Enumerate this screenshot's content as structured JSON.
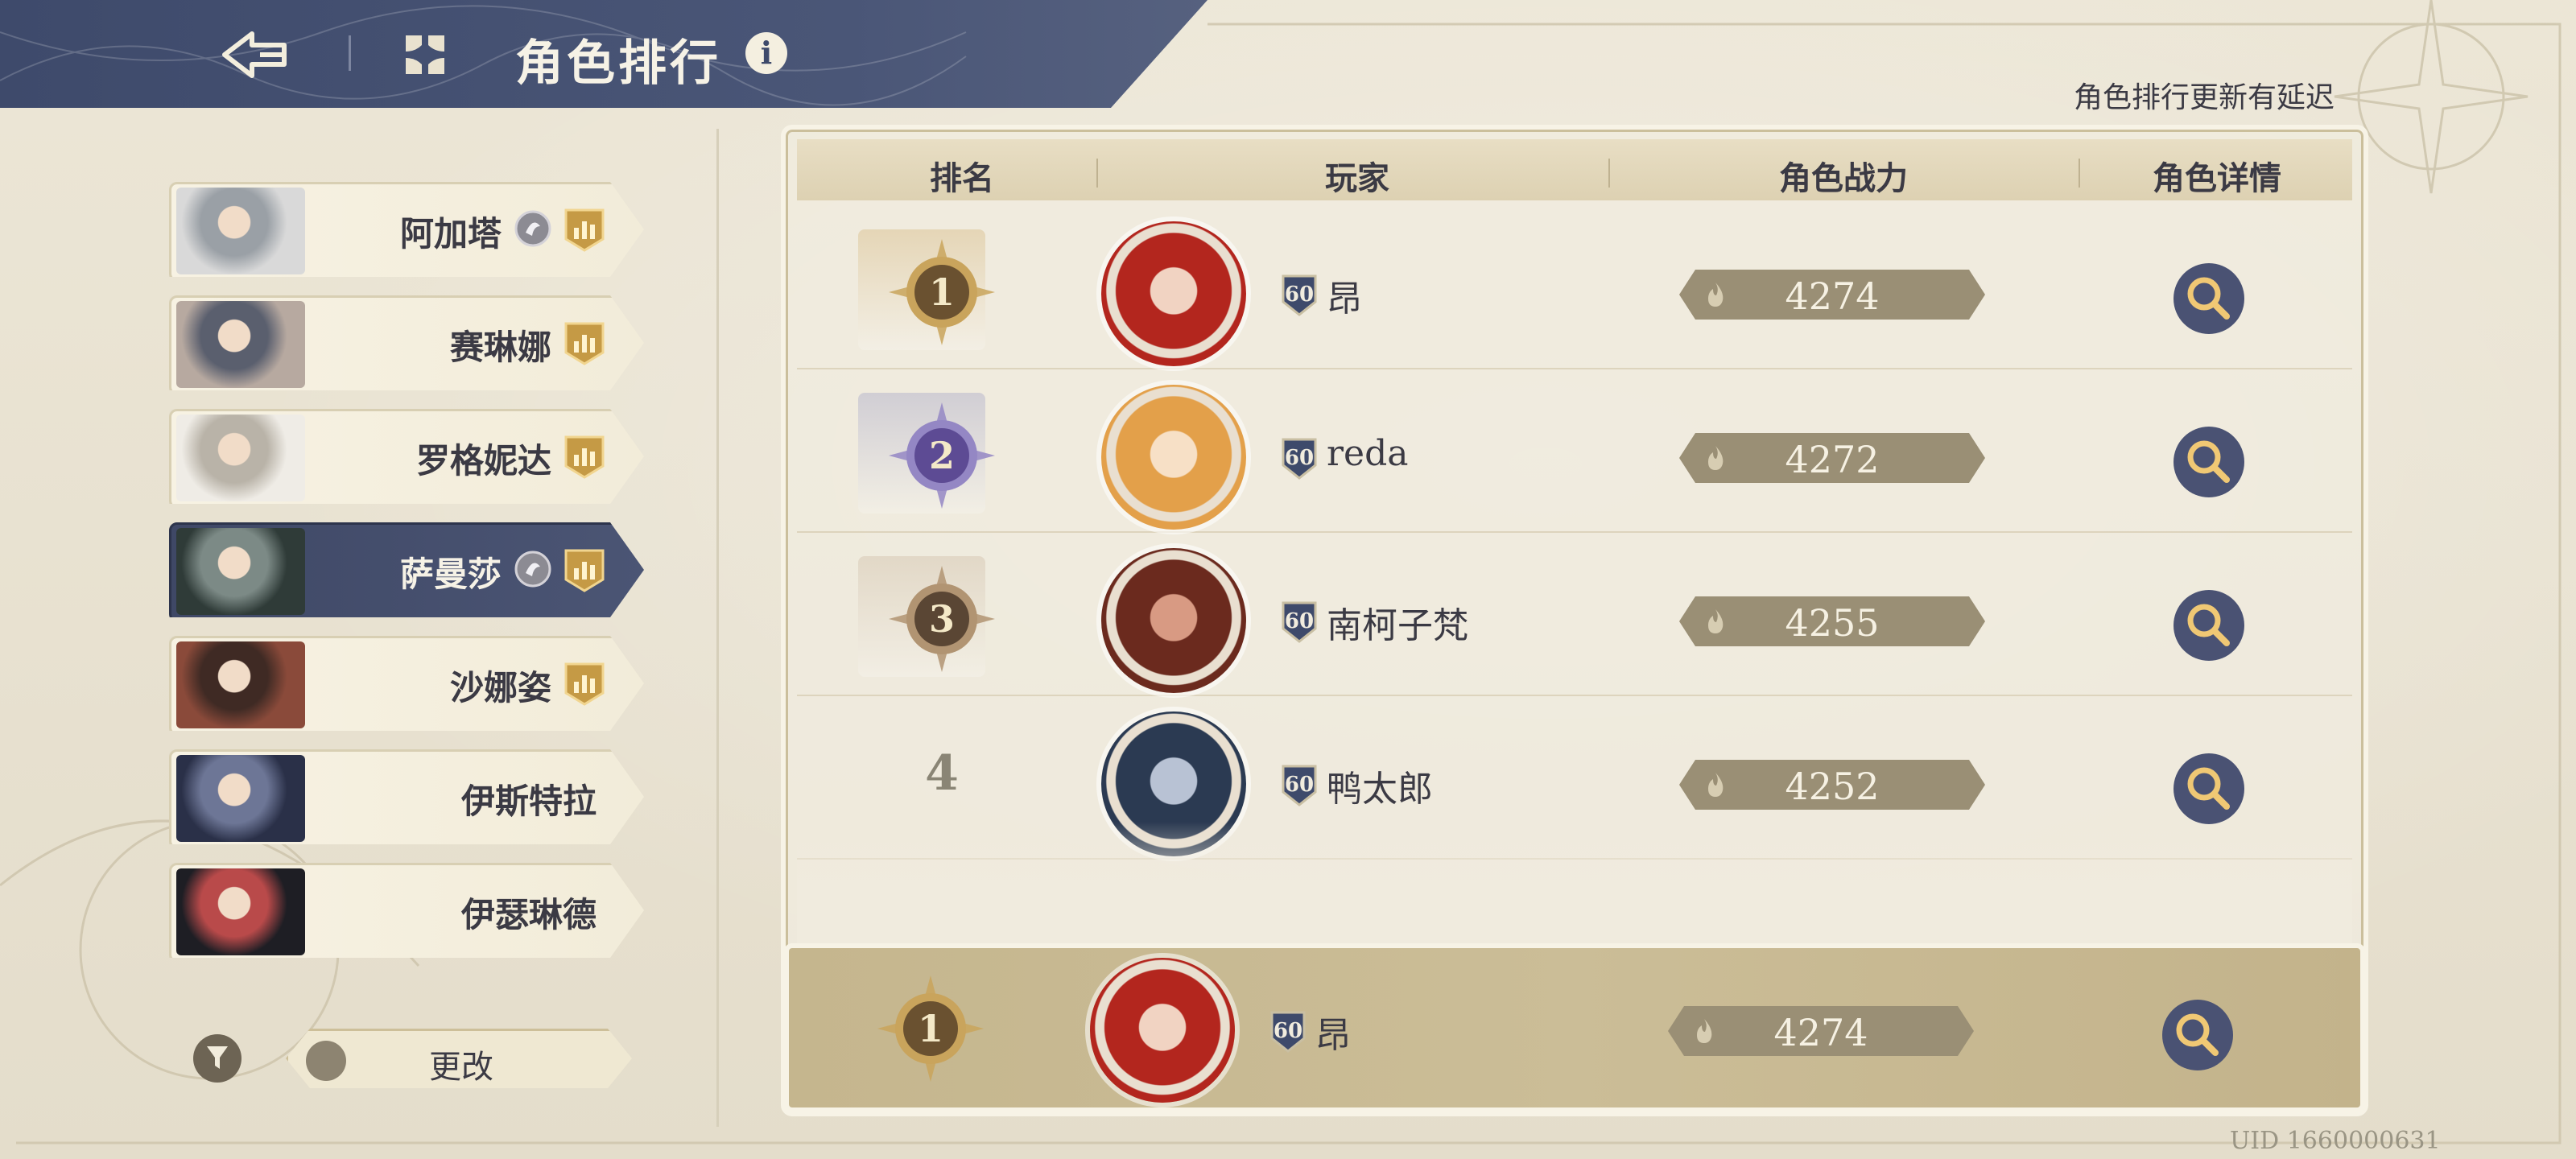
{
  "header": {
    "title": "角色排行",
    "back_icon": "back-arrow-icon",
    "menu_icon": "menu-grid-icon",
    "info_label": "i"
  },
  "delay_note": "角色排行更新有延迟",
  "uid": "UID 1660000631",
  "characters": [
    {
      "name": "阿加塔",
      "element_badge": true,
      "active": false
    },
    {
      "name": "赛琳娜",
      "element_badge": false,
      "active": false
    },
    {
      "name": "罗格妮达",
      "element_badge": false,
      "active": false
    },
    {
      "name": "萨曼莎",
      "element_badge": true,
      "active": true
    },
    {
      "name": "沙娜姿",
      "element_badge": false,
      "active": false
    },
    {
      "name": "伊斯特拉",
      "element_badge": false,
      "active": false
    },
    {
      "name": "伊瑟琳德",
      "element_badge": false,
      "active": false
    }
  ],
  "bottom_controls": {
    "change_label": "更改",
    "filter_icon": "filter-icon"
  },
  "table": {
    "columns": [
      "排名",
      "玩家",
      "角色战力",
      "角色详情"
    ],
    "rows": [
      {
        "rank": "1",
        "level": "60",
        "player": "昂",
        "power": "4274"
      },
      {
        "rank": "2",
        "level": "60",
        "player": "reda",
        "power": "4272"
      },
      {
        "rank": "3",
        "level": "60",
        "player": "南柯子梵",
        "power": "4255"
      },
      {
        "rank": "4",
        "level": "60",
        "player": "鸭太郎",
        "power": "4252"
      }
    ],
    "self": {
      "rank": "1",
      "level": "60",
      "player": "昂",
      "power": "4274"
    }
  },
  "colors": {
    "header_navy": "#3e4a6b",
    "gold": "#c9a45c",
    "silver_purple": "#7a6aa8",
    "bronze": "#8a6a4a",
    "power_pill": "#9a8f75",
    "self_row": "#c5b68e"
  }
}
